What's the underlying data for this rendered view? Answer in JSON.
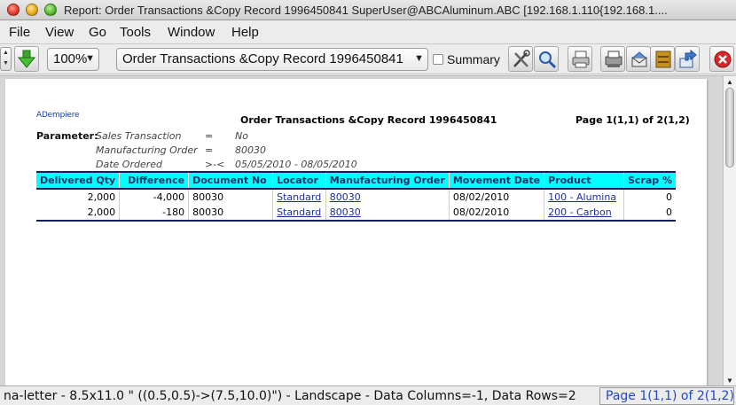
{
  "window": {
    "title": "Report: Order Transactions &Copy Record 1996450841  SuperUser@ABCAluminum.ABC [192.168.1.110{192.168.1...."
  },
  "menu": [
    "File",
    "View",
    "Go",
    "Tools",
    "Window",
    "Help"
  ],
  "toolbar": {
    "zoom": "100%",
    "report_select": "Order Transactions &Copy Record 1996450841",
    "summary_label": "Summary",
    "summary_checked": false,
    "icons": [
      "spinner-icon",
      "drill-down-arrow-icon",
      "customize-tools-icon",
      "find-magnifier-icon",
      "print-icon",
      "print-preview-icon",
      "send-email-icon",
      "archive-icon",
      "export-icon",
      "close-icon"
    ]
  },
  "report": {
    "logo": "ADempiere",
    "title": "Order Transactions &Copy Record 1996450841",
    "page_info": "Page 1(1,1) of 2(1,2)",
    "parameter_label": "Parameter:",
    "parameters": [
      {
        "name": "Sales Transaction",
        "op": "=",
        "value": "No"
      },
      {
        "name": "Manufacturing Order",
        "op": "=",
        "value": "80030"
      },
      {
        "name": "Date Ordered",
        "op": ">-<",
        "value": "05/05/2010 - 08/05/2010"
      }
    ],
    "columns": [
      "Delivered Qty",
      "Difference",
      "Document No",
      "Locator",
      "Manufacturing Order",
      "Movement Date",
      "Product",
      "Scrap %"
    ],
    "rows": [
      {
        "delivered_qty": "2,000",
        "difference": "-4,000",
        "document_no": "80030",
        "locator": "Standard",
        "manufacturing_order": "80030",
        "movement_date": "08/02/2010",
        "product": "100 - Alumina",
        "scrap": "0"
      },
      {
        "delivered_qty": "2,000",
        "difference": "-180",
        "document_no": "80030",
        "locator": "Standard",
        "manufacturing_order": "80030",
        "movement_date": "08/02/2010",
        "product": "200 - Carbon",
        "scrap": "0"
      }
    ]
  },
  "status": {
    "text": "na-letter - 8.5x11.0 \" ((0.5,0.5)->(7.5,10.0)\") - Landscape - Data Columns=-1, Data Rows=2",
    "page": "Page 1(1,1) of 2(1,2)"
  },
  "colors": {
    "header_bg": "#00ffff",
    "header_text": "#16306c",
    "link": "#1a2fa0",
    "status_page": "#2546c6"
  }
}
